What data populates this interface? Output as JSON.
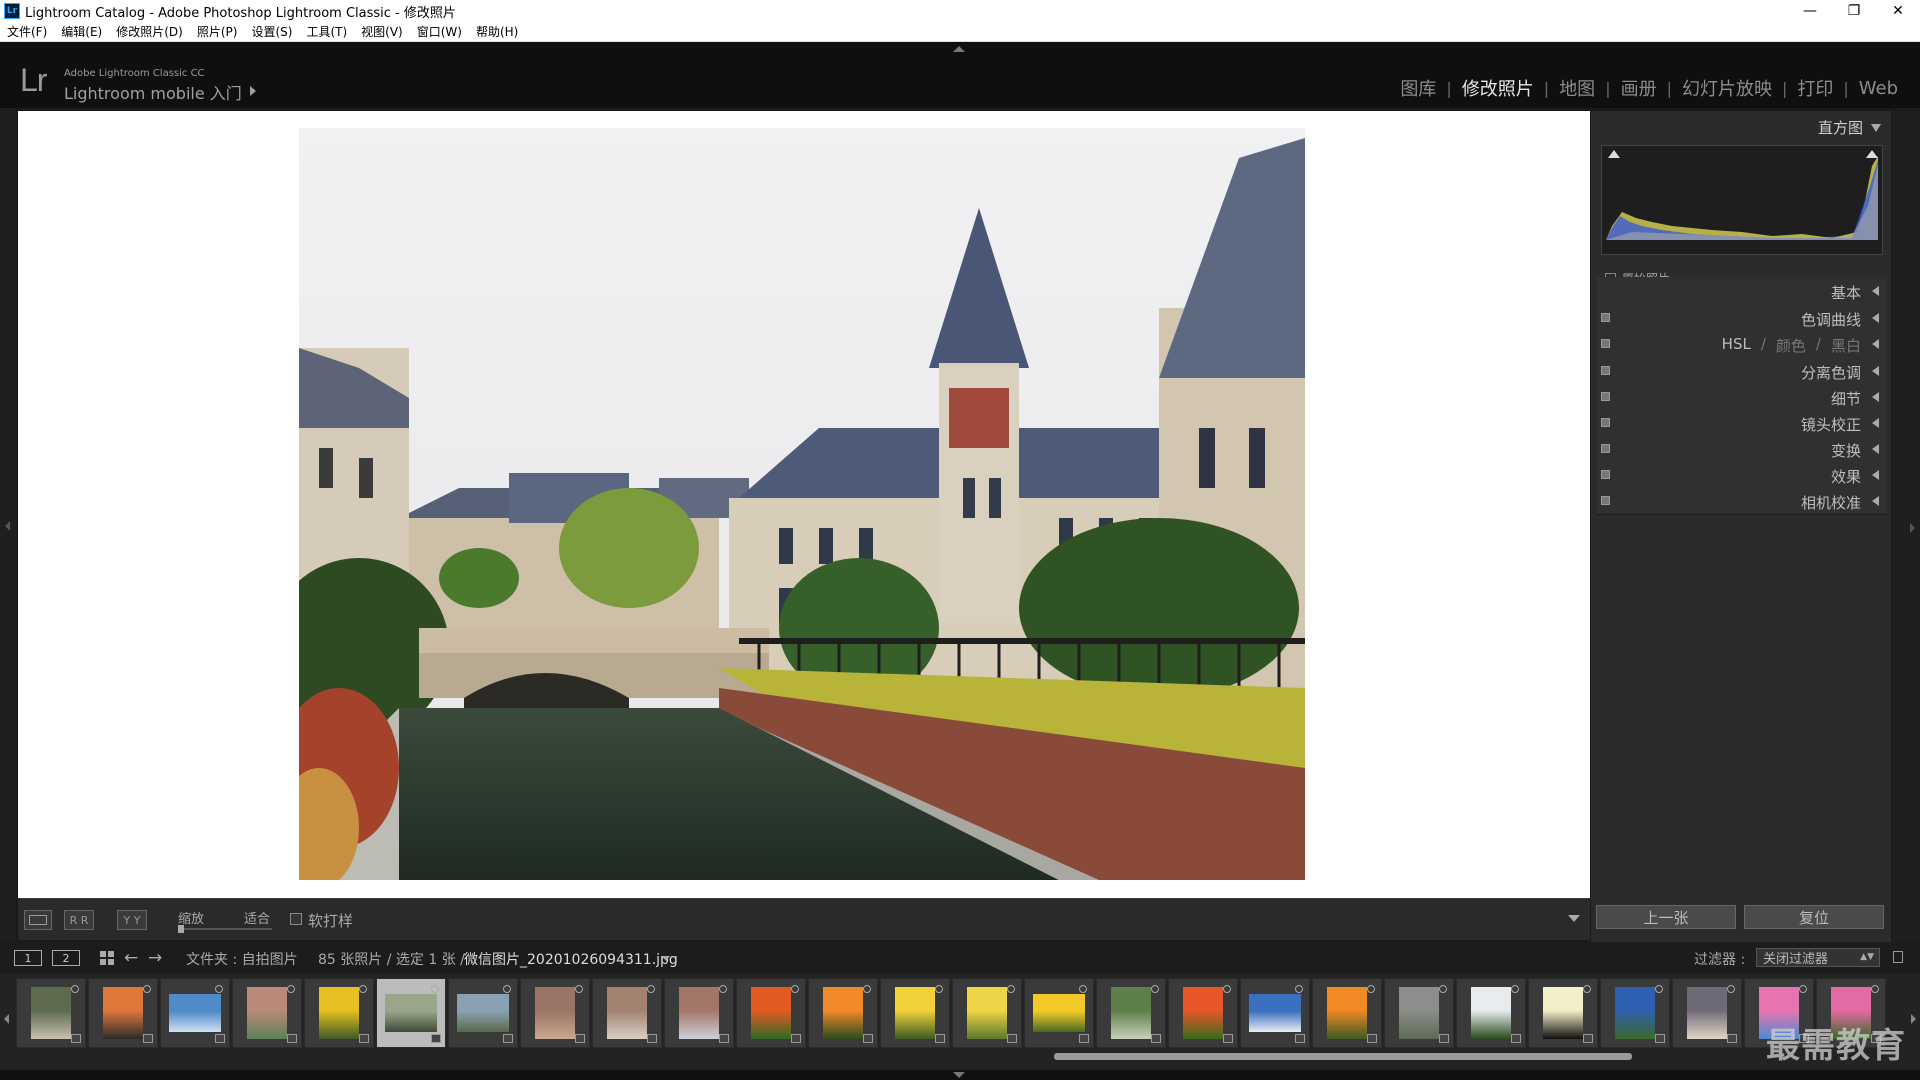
{
  "window": {
    "title": "Lightroom Catalog - Adobe Photoshop Lightroom Classic - 修改照片",
    "app_icon": "Lr",
    "controls": [
      "minimize-icon",
      "restore-icon",
      "close-icon"
    ]
  },
  "menubar": {
    "items": [
      "文件(F)",
      "编辑(E)",
      "修改照片(D)",
      "照片(P)",
      "设置(S)",
      "工具(T)",
      "视图(V)",
      "窗口(W)",
      "帮助(H)"
    ]
  },
  "identity": {
    "logo": "Lr",
    "line1": "Adobe Lightroom Classic CC",
    "line2": "Lightroom mobile 入门"
  },
  "modules": {
    "items": [
      "图库",
      "修改照片",
      "地图",
      "画册",
      "幻灯片放映",
      "打印",
      "Web"
    ],
    "active": "修改照片",
    "separator": "|"
  },
  "toolbar": {
    "zoom_label": "缩放",
    "zoom_fit": "适合",
    "soft_proof": "软打样",
    "view_btn_2": "R R",
    "view_btn_3": "Y Y"
  },
  "right_panel": {
    "histogram_title": "直方图",
    "original_photo": "原始照片",
    "sections": [
      {
        "label": "基本",
        "switch": false
      },
      {
        "label": "色调曲线",
        "switch": true
      },
      {
        "label": "HSL",
        "switch": true
      },
      {
        "label": "分离色调",
        "switch": true
      },
      {
        "label": "细节",
        "switch": true
      },
      {
        "label": "镜头校正",
        "switch": true
      },
      {
        "label": "变换",
        "switch": true
      },
      {
        "label": "效果",
        "switch": true
      },
      {
        "label": "相机校准",
        "switch": true
      }
    ],
    "hsl_parts": [
      "HSL",
      "/",
      "颜色",
      "/",
      "黑白"
    ],
    "prev_button": "上一张",
    "reset_button": "复位"
  },
  "filmstrip_bar": {
    "monitor1": "1",
    "monitor2": "2",
    "folder_path": "文件夹 : 自拍图片",
    "count": "85 张照片 / 选定 1 张 /",
    "filename": "微信图片_20201026094311.jpg",
    "filter_label": "过滤器 :",
    "filter_value": "关闭过滤器"
  },
  "filmstrip": {
    "selected_index": 5,
    "thumbs": [
      {
        "kind": "portrait",
        "colors": [
          "#5d6b4e",
          "#c8c0b0"
        ]
      },
      {
        "kind": "portrait",
        "colors": [
          "#e0773a",
          "#2b2b2b"
        ]
      },
      {
        "kind": "landscape",
        "colors": [
          "#4f8ac9",
          "#cfe0f2"
        ]
      },
      {
        "kind": "portrait",
        "colors": [
          "#b98a78",
          "#5e7f5a"
        ]
      },
      {
        "kind": "portrait",
        "colors": [
          "#e6c020",
          "#3f5a25"
        ]
      },
      {
        "kind": "landscape",
        "colors": [
          "#9aa68a",
          "#3f4a3a"
        ]
      },
      {
        "kind": "landscape",
        "colors": [
          "#8aa0b3",
          "#5a6a4a"
        ]
      },
      {
        "kind": "portrait",
        "colors": [
          "#9a7466",
          "#c9a991"
        ]
      },
      {
        "kind": "portrait",
        "colors": [
          "#a38272",
          "#d9cfc4"
        ]
      },
      {
        "kind": "portrait",
        "colors": [
          "#a27769",
          "#cfd0d8"
        ]
      },
      {
        "kind": "portrait",
        "colors": [
          "#e45a24",
          "#2f6b22"
        ]
      },
      {
        "kind": "portrait",
        "colors": [
          "#f08a2a",
          "#2c4a1c"
        ]
      },
      {
        "kind": "portrait",
        "colors": [
          "#f1d23a",
          "#3c5a20"
        ]
      },
      {
        "kind": "portrait",
        "colors": [
          "#eed447",
          "#5a7a2e"
        ]
      },
      {
        "kind": "landscape",
        "colors": [
          "#f2c928",
          "#4b6a1f"
        ]
      },
      {
        "kind": "portrait",
        "colors": [
          "#5e7e4a",
          "#c8d0b8"
        ]
      },
      {
        "kind": "portrait",
        "colors": [
          "#e8572a",
          "#3a6a1c"
        ]
      },
      {
        "kind": "landscape",
        "colors": [
          "#3b6fc0",
          "#e8eef6"
        ]
      },
      {
        "kind": "portrait",
        "colors": [
          "#f08a22",
          "#3f5a24"
        ]
      },
      {
        "kind": "portrait",
        "colors": [
          "#8b8e8a",
          "#5c6b56"
        ]
      },
      {
        "kind": "portrait",
        "colors": [
          "#e8ecef",
          "#2a4a1c"
        ]
      },
      {
        "kind": "portrait",
        "colors": [
          "#f2f0c8",
          "#0f0f0f"
        ]
      },
      {
        "kind": "portrait",
        "colors": [
          "#2f5fb0",
          "#3a6a2a"
        ]
      },
      {
        "kind": "portrait",
        "colors": [
          "#6f6a77",
          "#e2d6c8"
        ]
      },
      {
        "kind": "portrait",
        "colors": [
          "#e774b0",
          "#4c8bd0"
        ]
      },
      {
        "kind": "portrait",
        "colors": [
          "#e46aa3",
          "#3a6a2a"
        ]
      }
    ]
  },
  "watermark": "最需教育",
  "colors": {
    "panel_bg": "#2b2b2b",
    "top_bg": "#0f0f0f",
    "active_module": "#e6e6e6",
    "inactive_module": "#8c8c8c"
  }
}
